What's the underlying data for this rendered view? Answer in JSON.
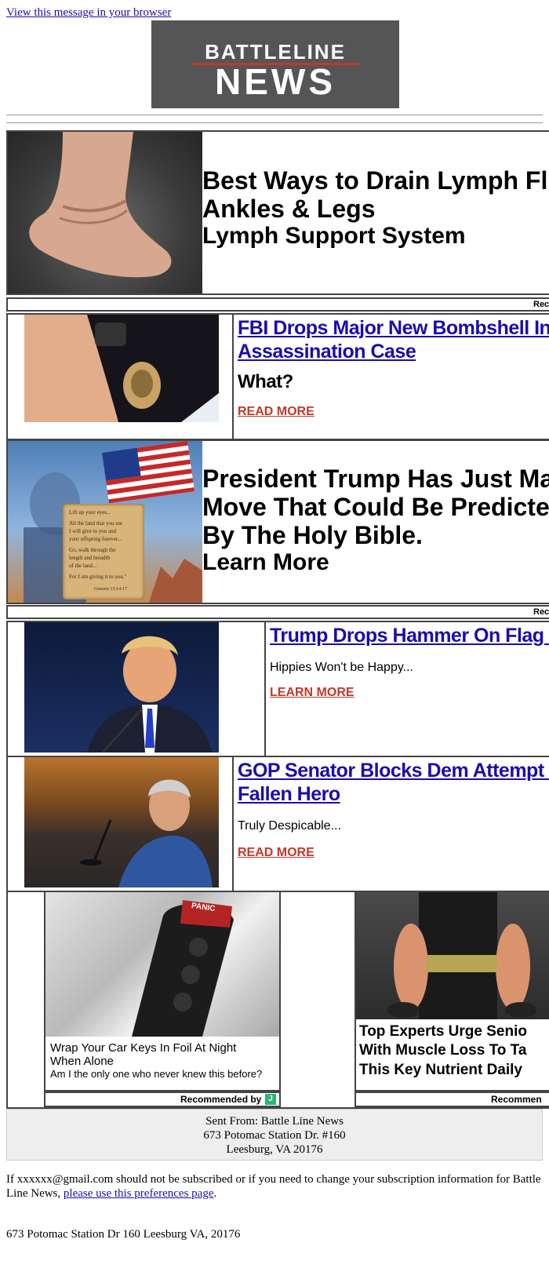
{
  "header": {
    "view_in_browser": "View this message in your browser",
    "logo_line1": "BATTLELINE",
    "logo_line2": "NEWS"
  },
  "ad1": {
    "image_icon": "swollen-foot-photo",
    "line1": "Best Ways to Drain Lymph Flu",
    "line2": "Ankles & Legs",
    "line3": "Lymph Support System"
  },
  "rec_bar1": "Rec",
  "story1": {
    "image_icon": "fbi-badge-photo",
    "title_line1": "FBI Drops Major New Bombshell In Charl",
    "title_line2": "Assassination Case",
    "subtitle": "What?",
    "cta": "READ MORE"
  },
  "ad2": {
    "image_icon": "bible-verse-flag-photo",
    "scripture": [
      "Lift up your eyes...",
      "All the land that you see",
      "I will give to you and",
      "your offspring forever...",
      "Go, walk through the",
      "length and breadth",
      "of the land...",
      "For I am giving it to you.\"",
      "Genesis 13:14-17"
    ],
    "line1": "President Trump Has Just Ma",
    "line2": "Move That Could Be Predicted",
    "line3": "By The Holy Bible.",
    "line4": "Learn More"
  },
  "rec_bar2": "Rec",
  "story2": {
    "image_icon": "trump-speaking-photo",
    "title": "Trump Drops Hammer On Flag Burne",
    "subtitle": "Hippies Won't be Happy...",
    "cta": "LEARN MORE"
  },
  "story3": {
    "image_icon": "senator-hearing-photo",
    "title_line1": "GOP Senator Blocks Dem Attempt To Dis",
    "title_line2": "Fallen Hero",
    "subtitle": "Truly Despicable...",
    "cta": "READ MORE"
  },
  "recommended": {
    "left": {
      "image_icon": "car-key-foil-photo",
      "panic_label": "PANIC",
      "title_line1": "Wrap Your Car Keys In Foil At Night",
      "title_line2": "When Alone",
      "subtitle": "Am I the only one who never knew this before?",
      "footer": "Recommended by",
      "badge": "J"
    },
    "right": {
      "image_icon": "muscle-arms-gym-photo",
      "title_line1": "Top Experts Urge Senio",
      "title_line2": "With Muscle Loss To Ta",
      "title_line3": "This Key Nutrient Daily",
      "footer": "Recommen"
    }
  },
  "footer": {
    "sent_from": "Sent From: Battle Line News",
    "address1": "673 Potomac Station Dr. #160",
    "address2": "Leesburg, VA 20176",
    "unsubscribe_text": "If xxxxxx@gmail.com should not be subscribed or if you need to change your subscription information for Battle Line News,",
    "preferences_link": "please use this preferences page",
    "period": ".",
    "postal": "673 Potomac Station Dr 160 Leesburg VA, 20176"
  },
  "colors": {
    "logo_bg": "#555555",
    "logo_red": "#c0392b",
    "link": "#1a0dab",
    "cta_red": "#c0392b"
  }
}
